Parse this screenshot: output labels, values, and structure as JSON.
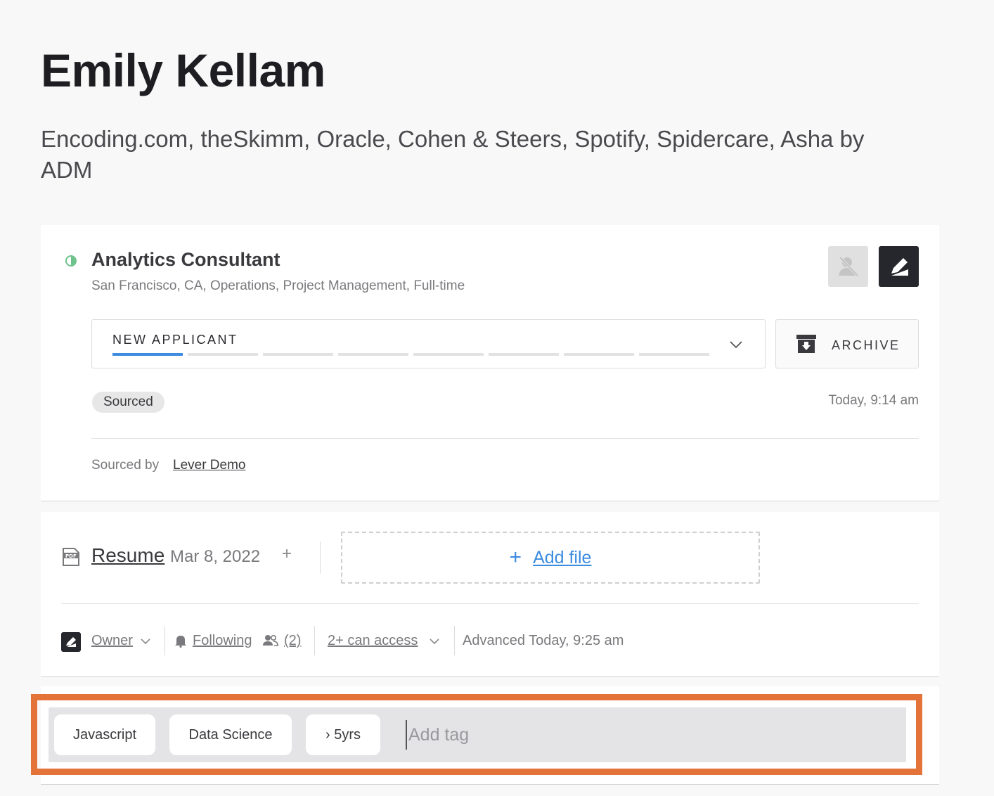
{
  "candidate": {
    "name": "Emily Kellam",
    "companies": "Encoding.com, theSkimm, Oracle, Cohen & Steers, Spotify, Spidercare, Asha by ADM"
  },
  "opportunity": {
    "job_title": "Analytics Consultant",
    "job_meta": "San Francisco, CA, Operations, Project Management, Full-time",
    "stage": "NEW APPLICANT",
    "archive_label": "ARCHIVE",
    "source_pill": "Sourced",
    "timestamp": "Today, 9:14 am",
    "sourced_by_label": "Sourced by",
    "sourced_by_name": "Lever Demo",
    "colors": {
      "active": "#6cc28a",
      "stage_progress": "#3d8ce0"
    }
  },
  "files": {
    "resume_label": "Resume",
    "resume_date": "Mar 8, 2022",
    "add_plus": "+",
    "add_file_plus": "+",
    "add_file_label": "Add file"
  },
  "meta": {
    "owner_label": "Owner",
    "following_label": "Following",
    "followers_count": "(2)",
    "access_label": "2+ can access",
    "advanced_text": "Advanced Today, 9:25 am"
  },
  "tags": {
    "items": [
      "Javascript",
      "Data Science",
      "› 5yrs"
    ],
    "input_placeholder": "Add tag",
    "highlight_color": "#e4733a"
  }
}
